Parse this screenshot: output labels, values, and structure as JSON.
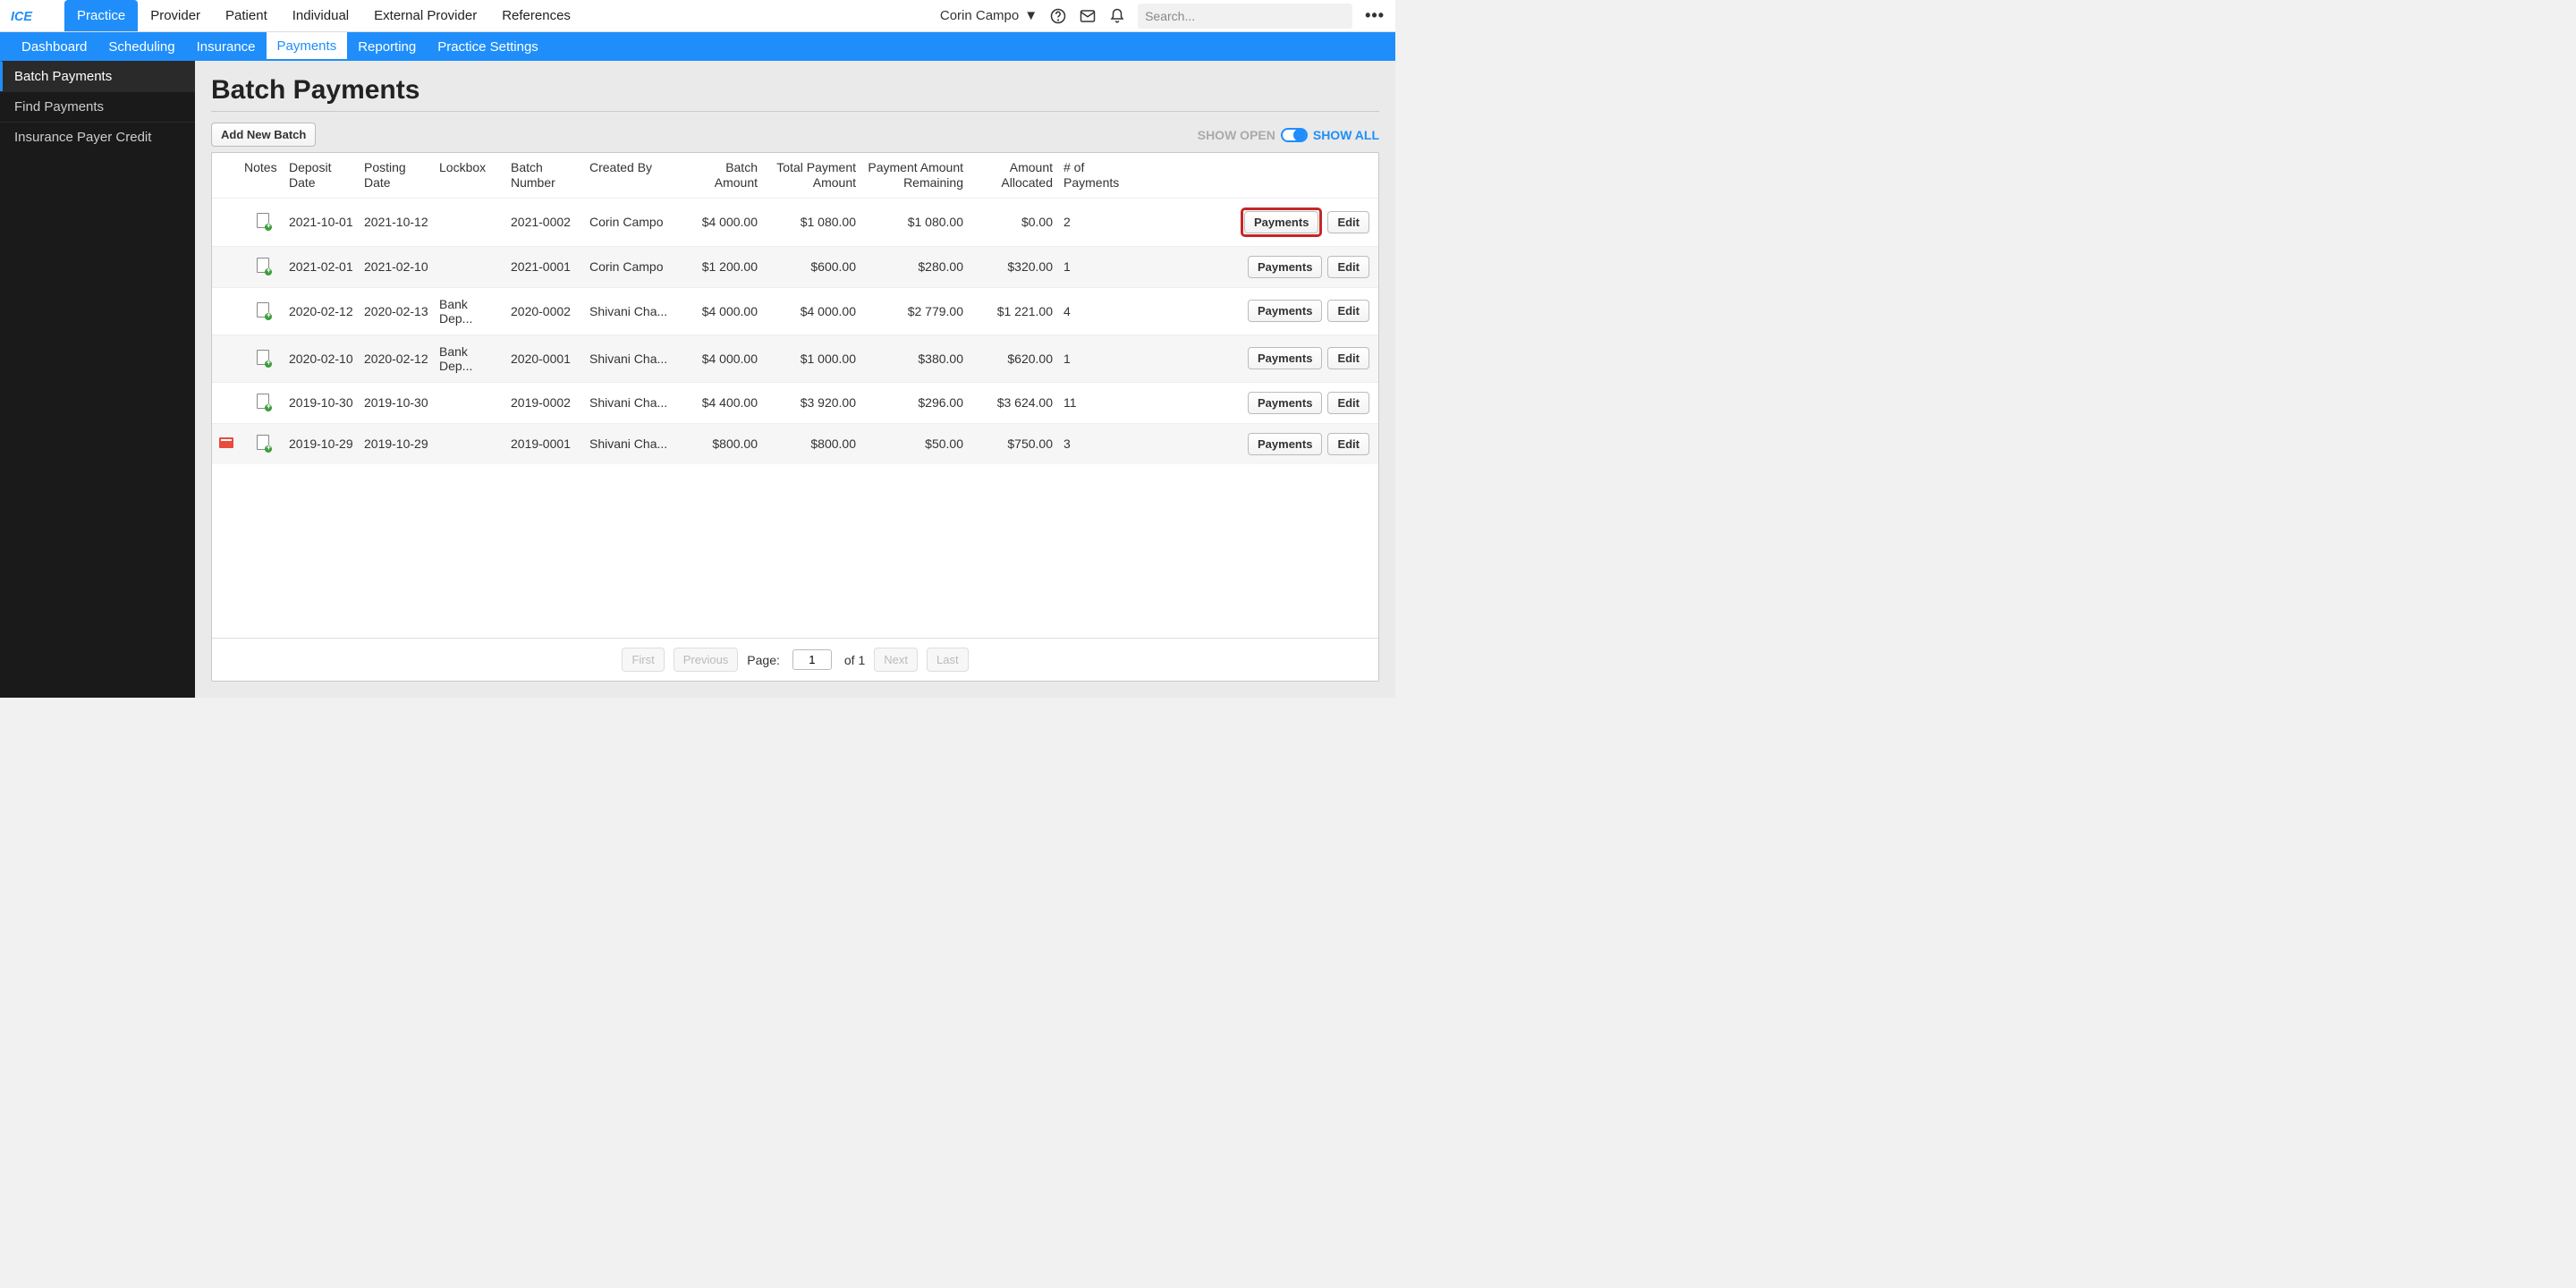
{
  "app": {
    "logo_text": "ICE"
  },
  "topnav": [
    "Practice",
    "Provider",
    "Patient",
    "Individual",
    "External Provider",
    "References"
  ],
  "topnav_active": 0,
  "user": {
    "name": "Corin Campo"
  },
  "search": {
    "placeholder": "Search..."
  },
  "subnav": [
    "Dashboard",
    "Scheduling",
    "Insurance",
    "Payments",
    "Reporting",
    "Practice Settings"
  ],
  "subnav_active": 3,
  "sidebar": [
    "Batch Payments",
    "Find Payments",
    "Insurance Payer Credit"
  ],
  "sidebar_active": 0,
  "page_title": "Batch Payments",
  "toolbar": {
    "add_button": "Add New Batch",
    "show_open": "SHOW OPEN",
    "show_all": "SHOW ALL"
  },
  "table": {
    "headers": [
      "",
      "Notes",
      "Deposit Date",
      "Posting Date",
      "Lockbox",
      "Batch Number",
      "Created By",
      "Batch Amount",
      "Total Payment Amount",
      "Payment Amount Remaining",
      "Amount Allocated",
      "# of Payments",
      "",
      ""
    ],
    "payments_btn": "Payments",
    "edit_btn": "Edit",
    "rows": [
      {
        "attach": false,
        "deposit": "2021-10-01",
        "posting": "2021-10-12",
        "lockbox": "",
        "batch_no": "2021-0002",
        "created_by": "Corin Campo",
        "batch_amount": "$4 000.00",
        "total_payment": "$1 080.00",
        "remaining": "$1 080.00",
        "allocated": "$0.00",
        "count": "2",
        "highlight": true
      },
      {
        "attach": false,
        "deposit": "2021-02-01",
        "posting": "2021-02-10",
        "lockbox": "",
        "batch_no": "2021-0001",
        "created_by": "Corin Campo",
        "batch_amount": "$1 200.00",
        "total_payment": "$600.00",
        "remaining": "$280.00",
        "allocated": "$320.00",
        "count": "1",
        "highlight": false
      },
      {
        "attach": false,
        "deposit": "2020-02-12",
        "posting": "2020-02-13",
        "lockbox": "Bank Dep...",
        "batch_no": "2020-0002",
        "created_by": "Shivani Cha...",
        "batch_amount": "$4 000.00",
        "total_payment": "$4 000.00",
        "remaining": "$2 779.00",
        "allocated": "$1 221.00",
        "count": "4",
        "highlight": false
      },
      {
        "attach": false,
        "deposit": "2020-02-10",
        "posting": "2020-02-12",
        "lockbox": "Bank Dep...",
        "batch_no": "2020-0001",
        "created_by": "Shivani Cha...",
        "batch_amount": "$4 000.00",
        "total_payment": "$1 000.00",
        "remaining": "$380.00",
        "allocated": "$620.00",
        "count": "1",
        "highlight": false
      },
      {
        "attach": false,
        "deposit": "2019-10-30",
        "posting": "2019-10-30",
        "lockbox": "",
        "batch_no": "2019-0002",
        "created_by": "Shivani Cha...",
        "batch_amount": "$4 400.00",
        "total_payment": "$3 920.00",
        "remaining": "$296.00",
        "allocated": "$3 624.00",
        "count": "11",
        "highlight": false
      },
      {
        "attach": true,
        "deposit": "2019-10-29",
        "posting": "2019-10-29",
        "lockbox": "",
        "batch_no": "2019-0001",
        "created_by": "Shivani Cha...",
        "batch_amount": "$800.00",
        "total_payment": "$800.00",
        "remaining": "$50.00",
        "allocated": "$750.00",
        "count": "3",
        "highlight": false
      }
    ]
  },
  "pager": {
    "first": "First",
    "previous": "Previous",
    "page_label": "Page:",
    "page_value": "1",
    "of_text": "of 1",
    "next": "Next",
    "last": "Last"
  }
}
